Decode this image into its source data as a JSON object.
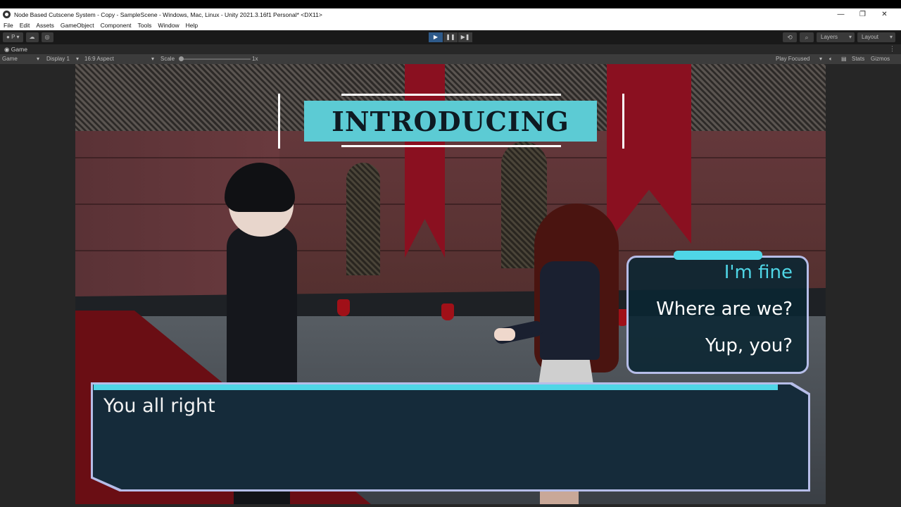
{
  "window": {
    "title": "Node Based Cutscene System - Copy - SampleScene - Windows, Mac, Linux - Unity 2021.3.16f1 Personal* <DX11>",
    "minimize": "—",
    "maximize": "❐",
    "close": "✕"
  },
  "menu": [
    "File",
    "Edit",
    "Assets",
    "GameObject",
    "Component",
    "Tools",
    "Window",
    "Help"
  ],
  "toolbar": {
    "account": "P",
    "play": "▶",
    "pause": "❚❚",
    "step": "▶❚",
    "layers": "Layers",
    "layout": "Layout"
  },
  "tab": {
    "label": "Game",
    "menu": "⋮"
  },
  "gamebar": {
    "view": "Game",
    "display": "Display 1",
    "aspect": "16:9 Aspect",
    "scale_label": "Scale",
    "scale_value": "1x",
    "play_mode": "Play Focused",
    "stats": "Stats",
    "gizmos": "Gizmos"
  },
  "game": {
    "banner": "INTRODUCING",
    "choices": [
      {
        "text": "I'm fine",
        "selected": true
      },
      {
        "text": "Where are we?",
        "selected": false
      },
      {
        "text": "Yup, you?",
        "selected": false
      }
    ],
    "dialogue": "You all right"
  },
  "colors": {
    "accent": "#4fd6e6",
    "frame": "#b6bde8",
    "banner_bg": "#5ccbd4",
    "play_active": "#2e5a8a"
  }
}
